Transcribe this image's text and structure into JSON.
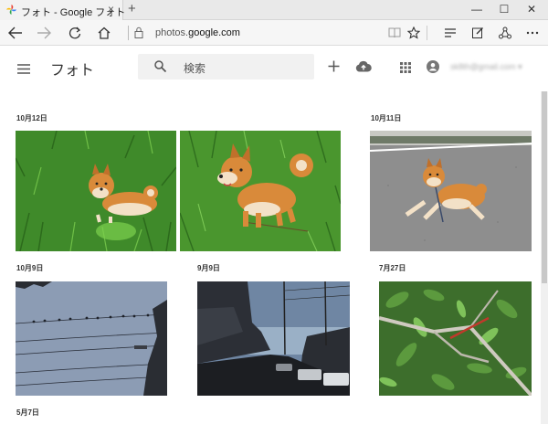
{
  "browser": {
    "tab_title": "フォト - Google フォト",
    "tab_close": "×",
    "new_tab": "+",
    "window_minimize": "—",
    "window_maximize": "☐",
    "window_close": "✕",
    "url_prefix": "photos.",
    "url_domain": "google.com"
  },
  "app": {
    "title": "フォト",
    "search_placeholder": "検索",
    "account_email": "sk8th@gmail.com ▾"
  },
  "sections": [
    {
      "date": "10月12日"
    },
    {
      "date": "10月11日"
    },
    {
      "date": "10月9日"
    },
    {
      "date": "9月9日"
    },
    {
      "date": "7月27日"
    },
    {
      "date": "5月7日"
    }
  ],
  "colors": {
    "accent": "#4285f4",
    "text": "#333333",
    "grass": "#3f8a2a",
    "dog": "#d98a3a",
    "sky_dusk": "#6f86a3"
  }
}
